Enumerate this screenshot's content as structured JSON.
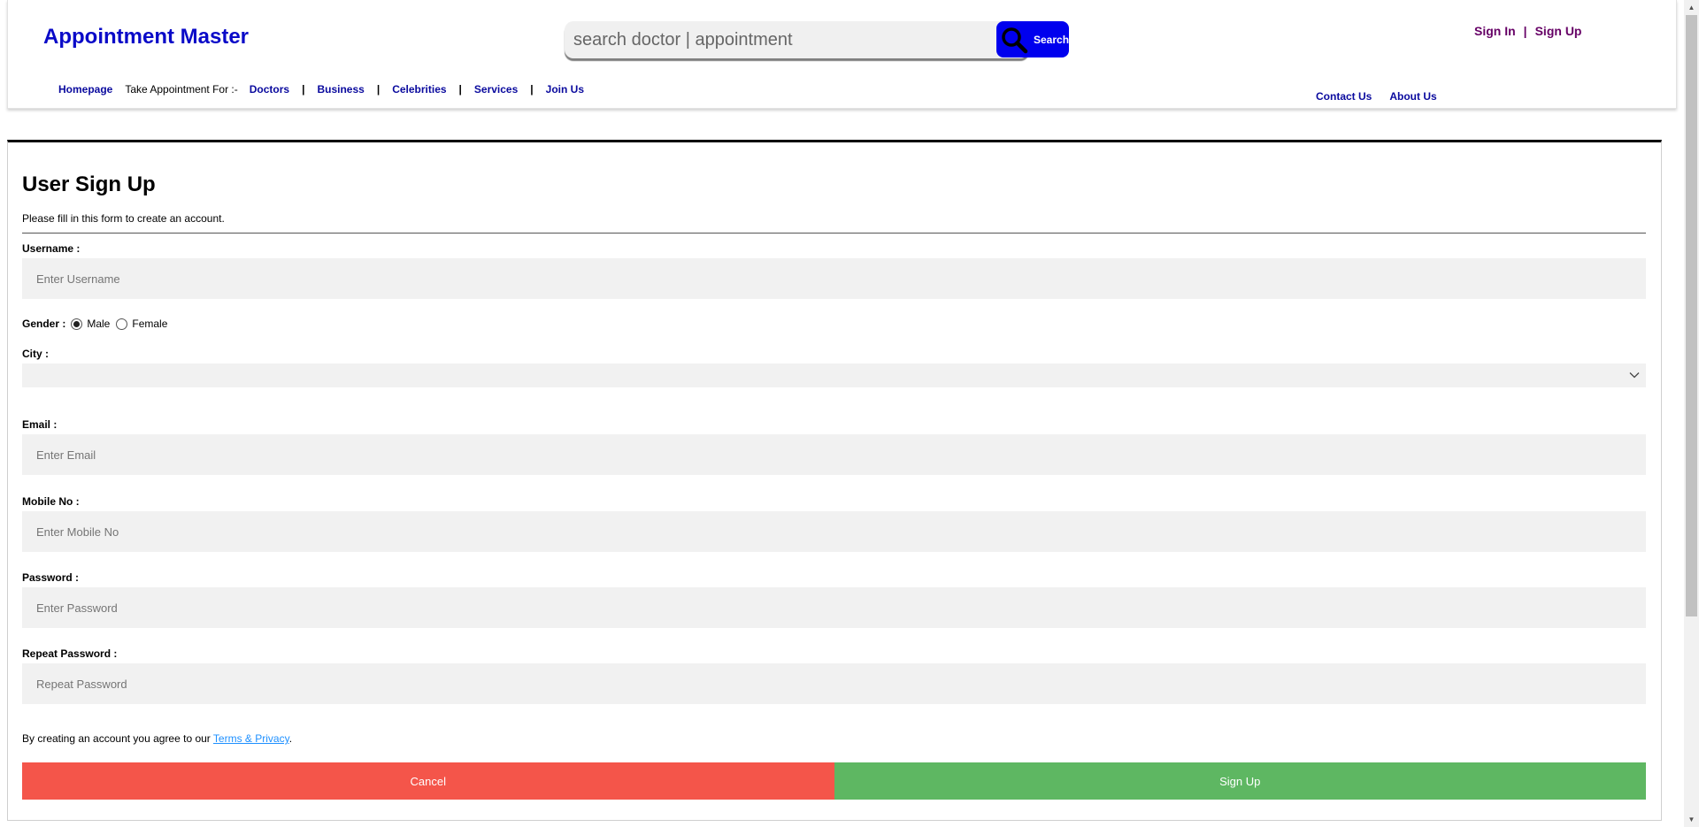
{
  "header": {
    "brand": "Appointment Master",
    "search": {
      "placeholder": "search doctor | appointment",
      "button_label": "Search"
    },
    "auth": {
      "sign_in": "Sign In",
      "separator": "|",
      "sign_up": "Sign Up"
    },
    "nav": {
      "homepage": "Homepage",
      "take_appointment": "Take Appointment For :-",
      "items": [
        "Doctors",
        "Business",
        "Celebrities",
        "Services",
        "Join Us"
      ],
      "separator": "|"
    },
    "nav_right": {
      "contact": "Contact Us",
      "about": "About Us"
    }
  },
  "form": {
    "title": "User Sign Up",
    "subtitle": "Please fill in this form to create an account.",
    "username": {
      "label": "Username :",
      "placeholder": "Enter Username"
    },
    "gender": {
      "label": "Gender :",
      "options": [
        "Male",
        "Female"
      ],
      "selected": "Male"
    },
    "city": {
      "label": "City :",
      "value": ""
    },
    "email": {
      "label": "Email :",
      "placeholder": "Enter Email"
    },
    "mobile": {
      "label": "Mobile No :",
      "placeholder": "Enter Mobile No"
    },
    "password": {
      "label": "Password :",
      "placeholder": "Enter Password"
    },
    "repeat_password": {
      "label": "Repeat Password :",
      "placeholder": "Repeat Password"
    },
    "terms": {
      "prefix": "By creating an account you agree to our ",
      "link": "Terms & Privacy",
      "suffix": "."
    },
    "cancel_label": "Cancel",
    "signup_label": "Sign Up"
  },
  "colors": {
    "brand": "#0a0ac8",
    "nav_link": "#0a0a9e",
    "auth_link": "#660066",
    "search_button": "#0000ee",
    "cancel": "#f4554a",
    "signup": "#5eb762",
    "input_bg": "#f1f1f1"
  },
  "icons": {
    "search": "search-icon",
    "select": "chevron-down-icon"
  }
}
